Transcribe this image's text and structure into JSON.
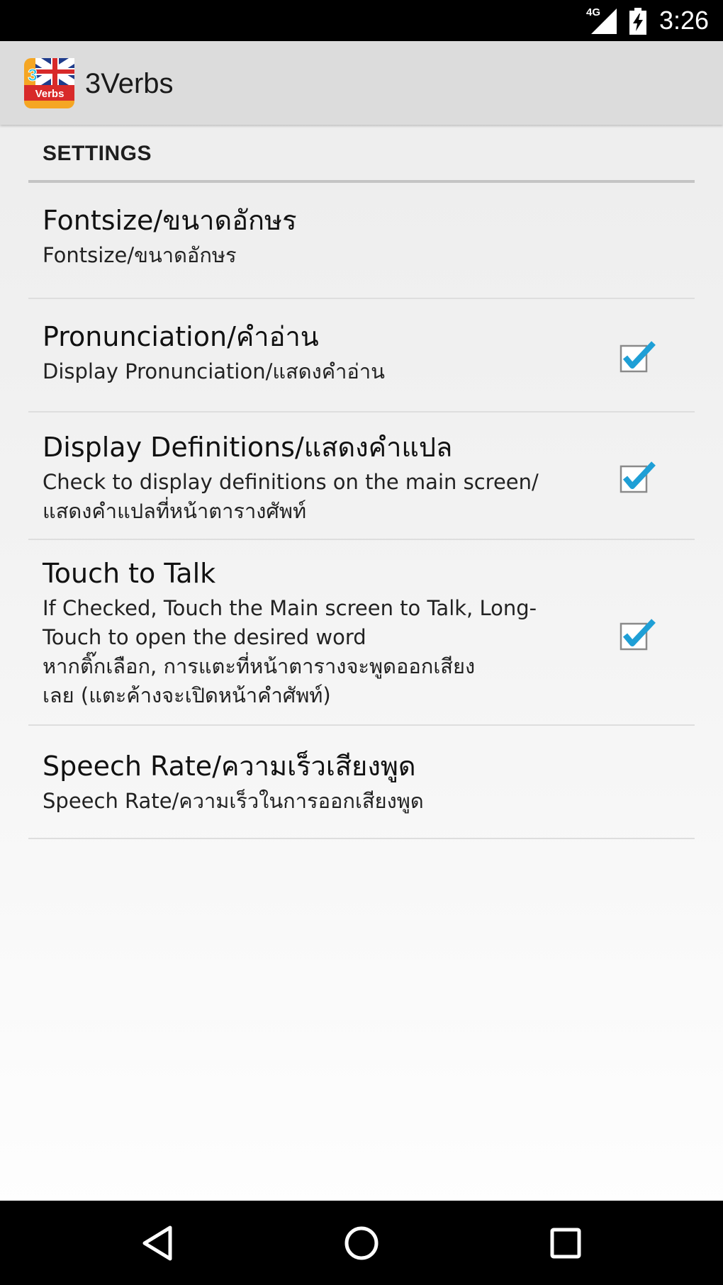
{
  "status_bar": {
    "network": "4G",
    "time": "3:26",
    "icons": [
      "signal-icon",
      "battery-charging-icon"
    ]
  },
  "app_bar": {
    "title": "3Verbs",
    "icon_text": "Verbs",
    "icon_digit": "3"
  },
  "settings": {
    "section_header": "SETTINGS",
    "items": [
      {
        "title": "Fontsize/ขนาดอักษร",
        "summary": "Fontsize/ขนาดอักษร"
      },
      {
        "title": "Pronunciation/คำอ่าน",
        "summary": "Display Pronunciation/แสดงคำอ่าน",
        "checked": true
      },
      {
        "title": "Display Definitions/แสดงคำแปล",
        "summary": "Check to display definitions on the main screen/\nแสดงคำแปลที่หน้าตารางศัพท์",
        "checked": true
      },
      {
        "title": "Touch to Talk",
        "summary": "If Checked, Touch the Main screen to Talk, Long-\nTouch to open the desired word\nหากติ๊กเลือก, การแตะที่หน้าตารางจะพูดออกเสียง\nเลย (แตะค้างจะเปิดหน้าคำศัพท์)",
        "checked": true
      },
      {
        "title": "Speech Rate/ความเร็วเสียงพูด",
        "summary": "Speech Rate/ความเร็วในการออกเสียงพูด"
      }
    ]
  },
  "colors": {
    "checkmark": "#1e9fd6",
    "status_bar_bg": "#000000",
    "action_bar_bg": "#dcdcdc",
    "divider": "#dedede"
  },
  "nav_bar": {
    "icons": [
      "back-icon",
      "home-icon",
      "recents-icon"
    ]
  }
}
